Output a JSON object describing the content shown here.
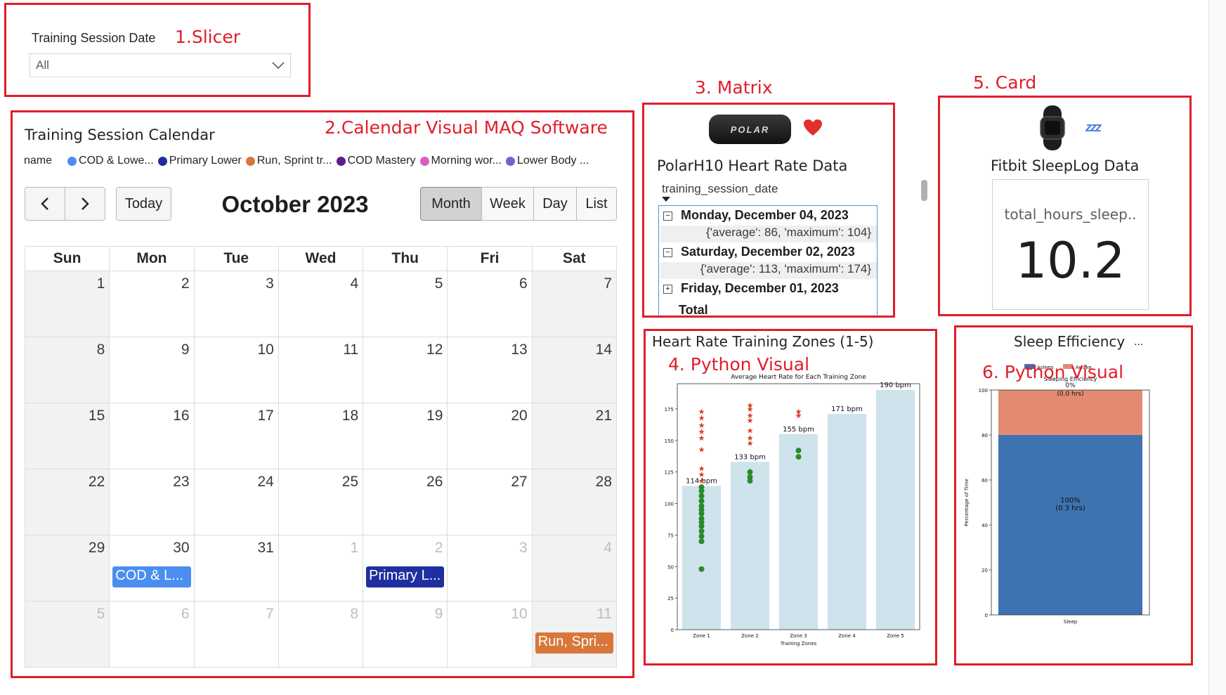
{
  "annotations": {
    "slicer": "1.Slicer",
    "calendar": "2.Calendar Visual MAQ Software",
    "matrix": "3. Matrix",
    "python1": "4. Python Visual",
    "card": "5. Card",
    "python2": "6. Python Visual"
  },
  "slicer": {
    "title": "Training Session Date",
    "value": "All"
  },
  "calendar": {
    "title": "Training Session Calendar",
    "legend_label": "name",
    "legend": [
      {
        "label": "COD & Lowe...",
        "color": "#4c8ef0"
      },
      {
        "label": "Primary Lower",
        "color": "#1f2fa0"
      },
      {
        "label": "Run, Sprint tr...",
        "color": "#d9773a"
      },
      {
        "label": "COD Mastery",
        "color": "#5c1d91"
      },
      {
        "label": "Morning wor...",
        "color": "#d65fc4"
      },
      {
        "label": "Lower Body ...",
        "color": "#7661d4"
      }
    ],
    "today": "Today",
    "month_label": "October 2023",
    "views": [
      "Month",
      "Week",
      "Day",
      "List"
    ],
    "weekdays": [
      "Sun",
      "Mon",
      "Tue",
      "Wed",
      "Thu",
      "Fri",
      "Sat"
    ],
    "weeks": [
      [
        "1",
        "2",
        "3",
        "4",
        "5",
        "6",
        "7"
      ],
      [
        "8",
        "9",
        "10",
        "11",
        "12",
        "13",
        "14"
      ],
      [
        "15",
        "16",
        "17",
        "18",
        "19",
        "20",
        "21"
      ],
      [
        "22",
        "23",
        "24",
        "25",
        "26",
        "27",
        "28"
      ],
      [
        "29",
        "30",
        "31",
        "1",
        "2",
        "3",
        "4"
      ],
      [
        "5",
        "6",
        "7",
        "8",
        "9",
        "10",
        "11"
      ]
    ],
    "events": {
      "cod": {
        "label": "COD & L...",
        "color": "#4c8ef0"
      },
      "primary": {
        "label": "Primary L...",
        "color": "#1f2fa0"
      },
      "run": {
        "label": "Run, Spri...",
        "color": "#d9773a"
      }
    }
  },
  "matrix": {
    "title": "PolarH10 Heart Rate Data",
    "logo_text": "POLAR",
    "field": "training_session_date",
    "rows": [
      {
        "date": "Monday, December 04, 2023",
        "value": "{'average': 86, 'maximum': 104}",
        "expander": "−"
      },
      {
        "date": "Saturday, December 02, 2023",
        "value": "{'average': 113, 'maximum': 174}",
        "expander": "−"
      },
      {
        "date": "Friday, December 01, 2023",
        "expander": "+"
      }
    ],
    "total": "Total"
  },
  "card": {
    "title": "Fitbit SleepLog Data",
    "field": "total_hours_sleep..",
    "value": "10.2"
  },
  "hr_visual": {
    "title": "Heart Rate Training Zones (1-5)"
  },
  "sleep_visual": {
    "title": "Sleep Efficiency",
    "more": "..."
  },
  "chart_data": [
    {
      "type": "bar",
      "title": "Average Heart Rate for Each Training Zone",
      "xlabel": "Training Zones",
      "ylabel": "",
      "categories": [
        "Zone 1",
        "Zone 2",
        "Zone 3",
        "Zone 4",
        "Zone 5"
      ],
      "values": [
        114,
        133,
        155,
        171,
        190
      ],
      "data_labels": [
        "114 bpm",
        "133 bpm",
        "155 bpm",
        "171 bpm",
        "190 bpm"
      ],
      "ylim": [
        0,
        195
      ],
      "yticks": [
        0,
        25,
        50,
        75,
        100,
        125,
        150,
        175
      ],
      "scatter_max": {
        "color": "#d63a1e",
        "points": [
          [
            1,
            173
          ],
          [
            1,
            168
          ],
          [
            1,
            162
          ],
          [
            1,
            157
          ],
          [
            1,
            152
          ],
          [
            1,
            143
          ],
          [
            1,
            128
          ],
          [
            1,
            123
          ],
          [
            1,
            118
          ],
          [
            2,
            178
          ],
          [
            2,
            175
          ],
          [
            2,
            170
          ],
          [
            2,
            166
          ],
          [
            2,
            158
          ],
          [
            2,
            152
          ],
          [
            2,
            148
          ],
          [
            3,
            173
          ],
          [
            3,
            170
          ]
        ]
      },
      "scatter_avg": {
        "color": "#2a8a2a",
        "points": [
          [
            1,
            113
          ],
          [
            1,
            110
          ],
          [
            1,
            106
          ],
          [
            1,
            102
          ],
          [
            1,
            98
          ],
          [
            1,
            95
          ],
          [
            1,
            92
          ],
          [
            1,
            88
          ],
          [
            1,
            85
          ],
          [
            1,
            82
          ],
          [
            1,
            78
          ],
          [
            1,
            74
          ],
          [
            1,
            70
          ],
          [
            1,
            48
          ],
          [
            2,
            125
          ],
          [
            2,
            121
          ],
          [
            2,
            118
          ],
          [
            3,
            142
          ],
          [
            3,
            137
          ]
        ]
      }
    },
    {
      "type": "bar",
      "title": "Sleeping Efficiency",
      "xlabel": "",
      "ylabel": "Percentage of Time",
      "categories": [
        "Sleep"
      ],
      "series": [
        {
          "name": "Asleep",
          "values": [
            100
          ],
          "color": "#3f72b0",
          "label": "100%",
          "sublabel": "(0.3 hrs)"
        },
        {
          "name": "Awake",
          "values": [
            0
          ],
          "color": "#e58a72",
          "label": "0%",
          "sublabel": "(0.0 hrs)"
        }
      ],
      "ylim": [
        0,
        100
      ],
      "yticks": [
        0,
        20,
        40,
        60,
        80,
        100
      ]
    }
  ]
}
